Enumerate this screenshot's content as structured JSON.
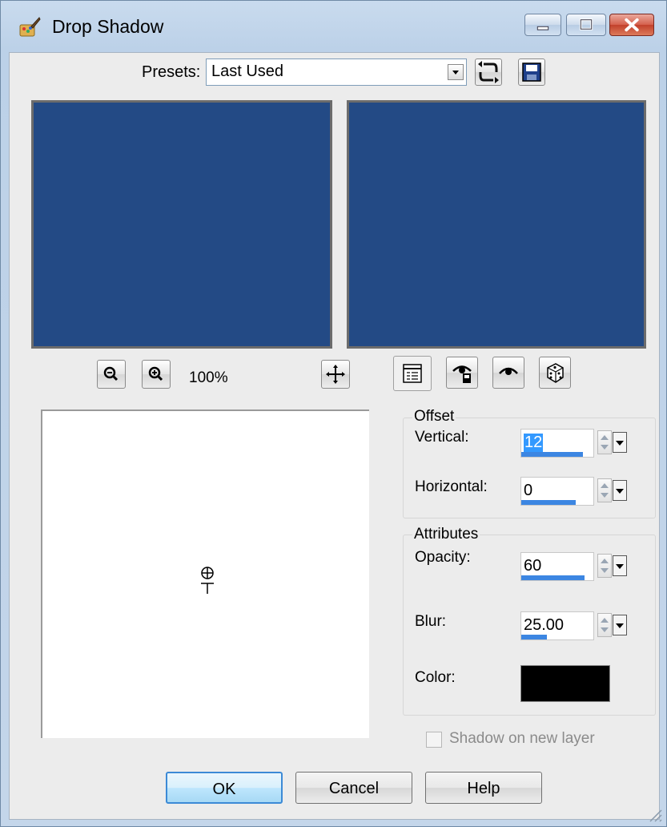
{
  "window": {
    "title": "Drop Shadow",
    "icons": [
      "paintbrush-app-icon",
      "minimize-icon",
      "maximize-icon",
      "close-icon"
    ]
  },
  "presets": {
    "label": "Presets:",
    "value": "Last Used",
    "icons": [
      "chevron-down-icon",
      "reset-icon",
      "save-icon"
    ]
  },
  "zoom": {
    "level": "100%",
    "icons": [
      "zoom-out-icon",
      "zoom-in-icon",
      "pan-icon"
    ]
  },
  "view_tools": {
    "icons": [
      "proof-icon",
      "auto-proof-icon",
      "preview-icon",
      "randomize-icon"
    ]
  },
  "offset": {
    "title": "Offset",
    "vertical_label": "Vertical:",
    "vertical_value": "12",
    "vertical_fill": 0.85,
    "horizontal_label": "Horizontal:",
    "horizontal_value": "0",
    "horizontal_fill": 0.76
  },
  "attributes": {
    "title": "Attributes",
    "opacity_label": "Opacity:",
    "opacity_value": "60",
    "opacity_fill": 0.88,
    "blur_label": "Blur:",
    "blur_value": "25.00",
    "blur_fill": 0.36,
    "color_label": "Color:",
    "color_value": "#000000"
  },
  "shadow_on_new_layer": {
    "label": "Shadow on new layer",
    "checked": false,
    "enabled": false
  },
  "buttons": {
    "ok": "OK",
    "cancel": "Cancel",
    "help": "Help"
  },
  "colors": {
    "preview_fill": "#234a85",
    "accent_bar": "#3c86e2",
    "selection": "#3399ff"
  }
}
